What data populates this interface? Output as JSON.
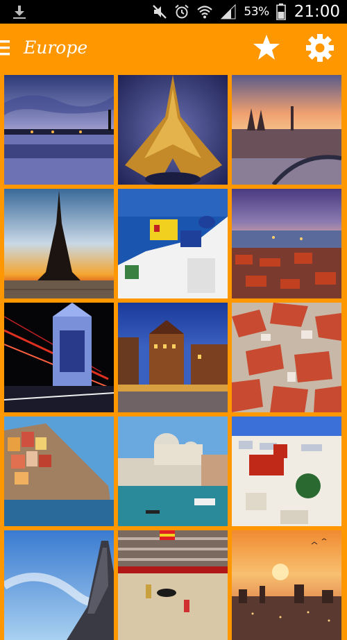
{
  "status_bar": {
    "battery_percent": "53%",
    "time": "21:00",
    "icons": [
      "download-icon",
      "mute-icon",
      "alarm-icon",
      "wifi-icon",
      "signal-icon",
      "battery-icon"
    ]
  },
  "app_bar": {
    "title": "Europe",
    "icons": [
      "menu-icon",
      "star-icon",
      "gear-icon"
    ]
  },
  "colors": {
    "accent": "#FF9800",
    "status_bar": "#000000",
    "icon": "#FFFFFF"
  },
  "gallery": {
    "columns": 3,
    "tiles": [
      {
        "subject": "river-city-night"
      },
      {
        "subject": "eiffel-tower-from-below"
      },
      {
        "subject": "cologne-cathedral-sunset"
      },
      {
        "subject": "eiffel-tower-sunset"
      },
      {
        "subject": "santorini-houses"
      },
      {
        "subject": "city-harbor-dusk"
      },
      {
        "subject": "tower-bridge-night"
      },
      {
        "subject": "canal-warehouses-night"
      },
      {
        "subject": "red-roof-old-town"
      },
      {
        "subject": "cinque-terre-village"
      },
      {
        "subject": "venice-grand-canal"
      },
      {
        "subject": "white-town-red-house"
      },
      {
        "subject": "eiffel-tower-blue-sky"
      },
      {
        "subject": "bullfight-arena"
      },
      {
        "subject": "city-skyline-sunset"
      }
    ]
  }
}
